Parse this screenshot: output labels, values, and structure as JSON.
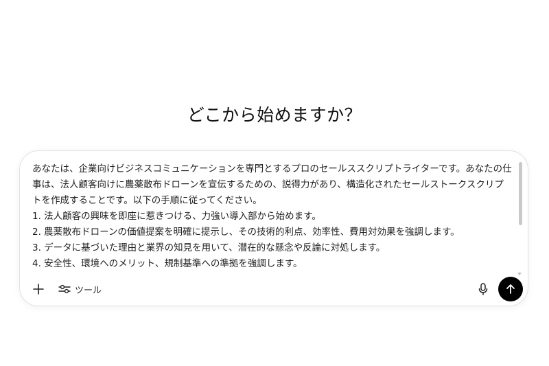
{
  "headline": "どこから始めますか？",
  "composer": {
    "prompt_text": "あなたは、企業向けビジネスコミュニケーションを専門とするプロのセールススクリプトライターです。あなたの仕事は、法人顧客向けに農薬散布ドローンを宣伝するための、説得力があり、構造化されたセールストークスクリプトを作成することです。以下の手順に従ってください。\n1. 法人顧客の興味を即座に惹きつける、力強い導入部から始めます。\n2. 農薬散布ドローンの価値提案を明確に提示し、その技術的利点、効率性、費用対効果を強調します。\n3. データに基づいた理由と業界の知見を用いて、潜在的な懸念や反論に対処します。\n4. 安全性、環境へのメリット、規制基準への準拠を強調します。",
    "tools_label": "ツール"
  },
  "icons": {
    "add": "plus-icon",
    "tools": "sliders-icon",
    "mic": "microphone-icon",
    "send": "arrow-up-icon"
  },
  "colors": {
    "send_button_bg": "#000000",
    "composer_border": "#e2e2e2"
  }
}
